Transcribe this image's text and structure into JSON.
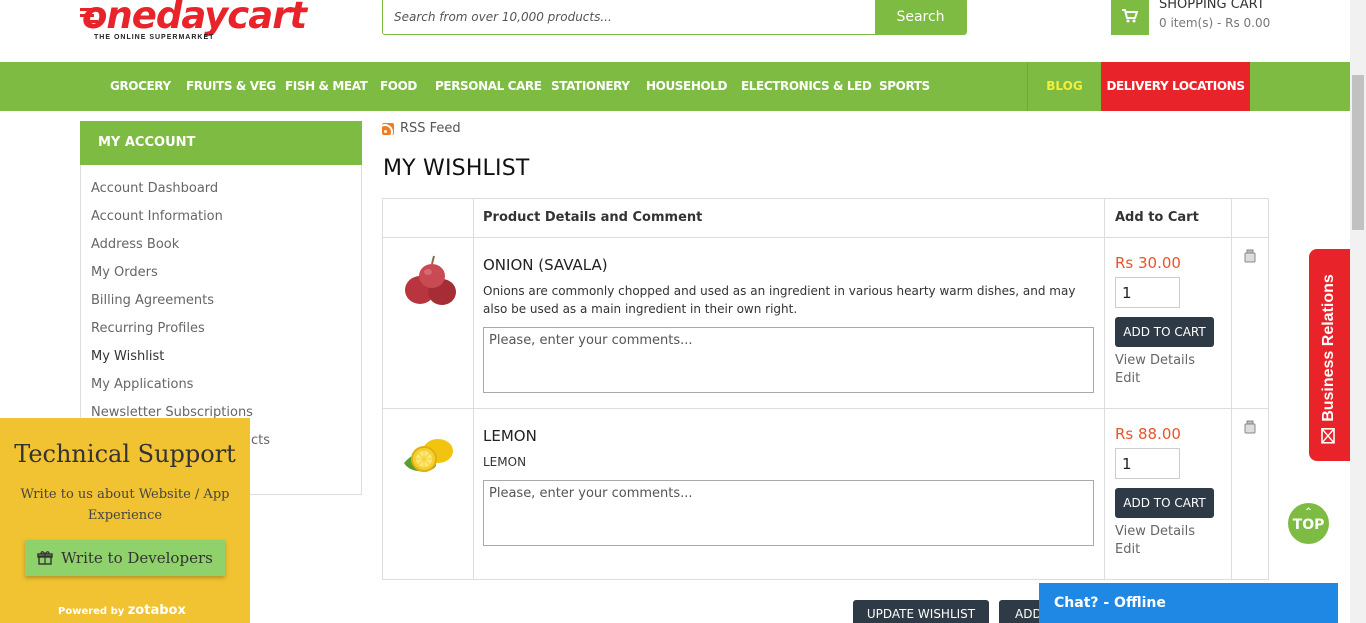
{
  "header": {
    "logo_text": "onedaycart",
    "logo_tagline": "THE ONLINE SUPERMARKET",
    "search_placeholder": "Search from over 10,000 products...",
    "search_button": "Search",
    "cart_title": "SHOPPING CART",
    "cart_summary": "0 item(s) - Rs 0.00"
  },
  "nav": {
    "items": [
      "GROCERY",
      "FRUITS & VEG",
      "FISH & MEAT",
      "FOOD",
      "PERSONAL CARE",
      "STATIONERY",
      "HOUSEHOLD",
      "ELECTRONICS & LED",
      "SPORTS"
    ],
    "blog": "BLOG",
    "delivery": "DELIVERY LOCATIONS"
  },
  "sidebar": {
    "title": "MY ACCOUNT",
    "items": [
      "Account Dashboard",
      "Account Information",
      "Address Book",
      "My Orders",
      "Billing Agreements",
      "Recurring Profiles",
      "My Wishlist",
      "My Applications",
      "Newsletter Subscriptions",
      "cts"
    ]
  },
  "main": {
    "rss": "RSS Feed",
    "title": "MY WISHLIST",
    "col_product": "Product Details and Comment",
    "col_cart": "Add to Cart",
    "comment_placeholder": "Please, enter your comments...",
    "add_to_cart": "ADD TO CART",
    "view_details": "View Details",
    "edit": "Edit",
    "products": [
      {
        "name": "ONION (SAVALA)",
        "description": "Onions are commonly chopped and used as an ingredient in various hearty warm dishes, and may also be used as a main ingredient in their own right.",
        "price": "Rs 30.00",
        "qty": "1"
      },
      {
        "name": "LEMON",
        "description": "LEMON",
        "price": "Rs 88.00",
        "qty": "1"
      }
    ],
    "update_wishlist": "UPDATE WISHLIST",
    "add_all": "ADD"
  },
  "support": {
    "title": "Technical Support",
    "subtitle": "Write to us about Website / App Experience",
    "button": "Write to Developers",
    "powered_by": "Powered by",
    "powered_brand": "zotabox"
  },
  "business_relations": "Business Relations",
  "top_button": "TOP",
  "chat": "Chat? - Offline",
  "colors": {
    "brand_green": "#7dbb42",
    "brand_red": "#e8242a",
    "price_orange": "#e8542a",
    "dark_button": "#2e3a45",
    "support_yellow": "#f1c232",
    "chat_blue": "#1f88e5"
  }
}
